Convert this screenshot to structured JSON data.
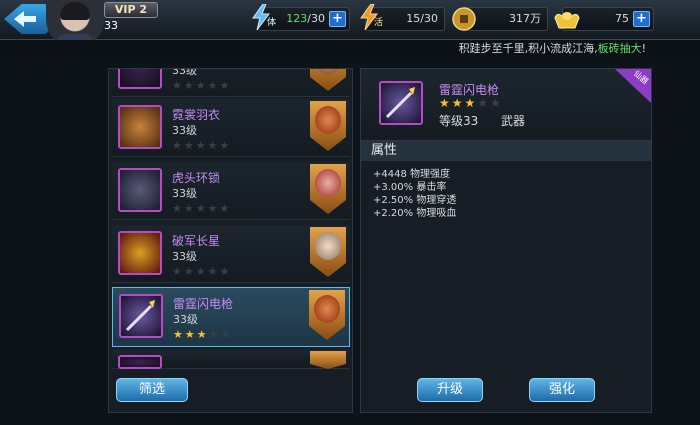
{
  "header": {
    "vip_label": "VIP 2",
    "player_level": "33",
    "stamina": {
      "icon": "stamina-bolt-icon",
      "label": "体",
      "current": "123",
      "max": "/30"
    },
    "energy": {
      "icon": "energy-bolt-icon",
      "label": "活",
      "value": "15/30"
    },
    "coins": {
      "icon": "coin-icon",
      "value": "317万"
    },
    "ingots": {
      "icon": "gold-ingot-icon",
      "value": "75"
    },
    "plus_symbol": "+"
  },
  "news": {
    "text_a": "积跬步至千里,积小流成江海,",
    "text_b": "板砖抽大",
    "text_c": "!"
  },
  "equipment_list": [
    {
      "name": "",
      "level": "33级",
      "stars": 0
    },
    {
      "name": "霓裳羽衣",
      "level": "33级",
      "stars": 0
    },
    {
      "name": "虎头环锁",
      "level": "33级",
      "stars": 0
    },
    {
      "name": "破军长星",
      "level": "33级",
      "stars": 0
    },
    {
      "name": "雷霆闪电枪",
      "level": "33级",
      "stars": 3,
      "selected": true
    },
    {
      "name": "",
      "level": "",
      "stars": 0
    }
  ],
  "filter_button": "筛选",
  "detail": {
    "ribbon": "仙器",
    "name": "雷霆闪电枪",
    "stars": 3,
    "level": "等级33",
    "type": "武器",
    "attr_title": "属性",
    "attrs": [
      "+4448 物理强度",
      "+3.00% 暴击率",
      "+2.50% 物理穿透",
      "+2.20% 物理吸血"
    ]
  },
  "upgrade_button": "升级",
  "enhance_button": "强化",
  "colors": {
    "accent": "#1e6fc8",
    "purple_name": "#c58bf0",
    "star": "#f6c12a",
    "highlight": "#f6c12a"
  }
}
